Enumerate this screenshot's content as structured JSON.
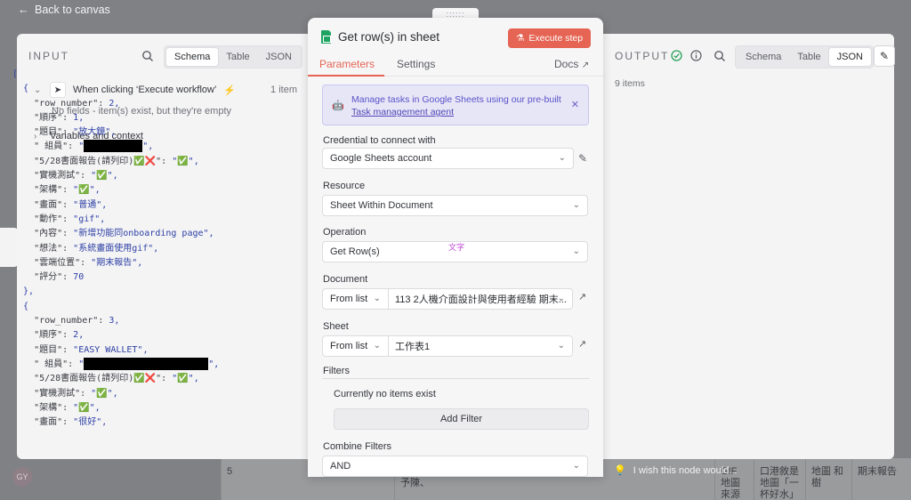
{
  "nav": {
    "back_label": "Back to canvas"
  },
  "input": {
    "title": "INPUT",
    "tabs": [
      "Schema",
      "Table",
      "JSON"
    ],
    "active_tab": "Schema",
    "trigger_label": "When clicking ‘Execute workflow’",
    "trigger_count": "1 item",
    "empty_note": "No fields - item(s) exist, but they're empty",
    "variables_label": "Variables and context"
  },
  "node": {
    "handle": "::::::",
    "title": "Get row(s) in sheet",
    "execute_label": "Execute step",
    "tabs": {
      "parameters": "Parameters",
      "settings": "Settings",
      "docs": "Docs"
    },
    "callout": {
      "text": "Manage tasks in Google Sheets using our pre-built",
      "link": "Task management agent"
    },
    "overlay_text": "文字",
    "fields": {
      "credential_label": "Credential to connect with",
      "credential_value": "Google Sheets account",
      "resource_label": "Resource",
      "resource_value": "Sheet Within Document",
      "operation_label": "Operation",
      "operation_value": "Get Row(s)",
      "document_label": "Document",
      "document_mode": "From list",
      "document_value": "113 2人機介面設計與使用者經驗 期末...",
      "sheet_label": "Sheet",
      "sheet_mode": "From list",
      "sheet_value": "工作表1",
      "filters_label": "Filters",
      "filters_empty": "Currently no items exist",
      "add_filter_label": "Add Filter",
      "combine_label": "Combine Filters",
      "combine_value": "AND"
    }
  },
  "output": {
    "title": "OUTPUT",
    "tabs": [
      "Schema",
      "Table",
      "JSON"
    ],
    "active_tab": "JSON",
    "count": "9 items",
    "feedback": "I wish this node would..."
  },
  "json_lines": [
    {
      "t": "["
    },
    {
      "t": "  {"
    },
    {
      "k": "row_number",
      "v": "2",
      "num": true
    },
    {
      "k": "順序",
      "v": "1",
      "num": true
    },
    {
      "k": "題目",
      "v": "放大鏡"
    },
    {
      "k": " 組員",
      "redact": 66
    },
    {
      "k": "5/28書面報告(請列印)✅❌",
      "v": "✅"
    },
    {
      "k": "實機測試",
      "v": "✅"
    },
    {
      "k": "架構",
      "v": "✅"
    },
    {
      "k": "畫面",
      "v": "普通"
    },
    {
      "k": "動作",
      "v": "gif"
    },
    {
      "k": "內容",
      "v": "新增功能同onboarding page"
    },
    {
      "k": "想法",
      "v": "系統畫面使用gif"
    },
    {
      "k": "雲端位置",
      "v": "期末報告"
    },
    {
      "k": "評分",
      "v": "70",
      "num": true,
      "last": true
    },
    {
      "t": "  },"
    },
    {
      "t": "  {"
    },
    {
      "k": "row_number",
      "v": "3",
      "num": true
    },
    {
      "k": "順序",
      "v": "2",
      "num": true
    },
    {
      "k": "題目",
      "v": "EASY WALLET"
    },
    {
      "k": " 組員",
      "redact": 140
    },
    {
      "k": "5/28書面報告(請列印)✅❌",
      "v": "✅"
    },
    {
      "k": "實機測試",
      "v": "✅"
    },
    {
      "k": "架構",
      "v": "✅"
    },
    {
      "k": "畫面",
      "v": "很好"
    }
  ],
  "background": {
    "row_number": "5",
    "cells": [
      "GIF 地圖來源",
      "口港敘是地圖「一杯好水」",
      "地圖 和樹",
      "期末報告"
    ],
    "under_modal": "第、題予陳、",
    "avatar": "GY"
  }
}
